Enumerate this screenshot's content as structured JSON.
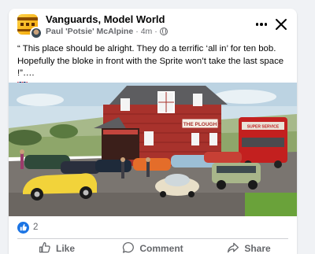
{
  "post": {
    "group_name": "Vanguards, Model World",
    "author": "Paul 'Potsie' McAlpine",
    "separator": "·",
    "time": "4m",
    "separator2": "·",
    "text": "“ This place should be alright. They do a terrific ‘all in’ for ten bob. Hopefully the bloke in front with the Sprite won’t take the last space !”….",
    "flag": "uk-flag-icon",
    "privacy_icon": "globe-icon"
  },
  "photo": {
    "sign_text": "THE PLOUGH",
    "bus_sign": "SUPER SERVICE"
  },
  "reactions": {
    "type": "like-icon",
    "count": "2"
  },
  "actions": [
    {
      "label": "Like",
      "icon": "thumbs-up-icon"
    },
    {
      "label": "Comment",
      "icon": "comment-icon"
    },
    {
      "label": "Share",
      "icon": "share-icon"
    }
  ],
  "colors": {
    "like_blue": "#1b74e4",
    "secondary_text": "#65676b",
    "primary_text": "#050505"
  }
}
